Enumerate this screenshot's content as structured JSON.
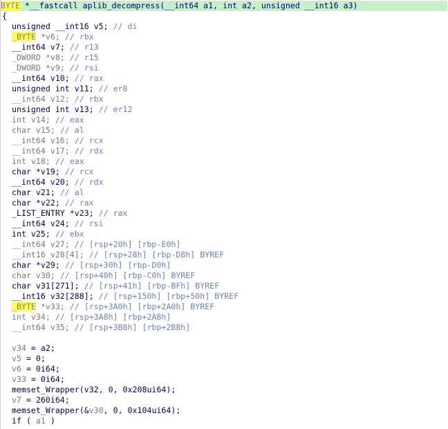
{
  "function_signature": [
    {
      "t": "BYTE",
      "c": "hl"
    },
    {
      "t": " *__fastcall aplib_decompress(__int64 a1, int a2, unsigned __int16 a3)",
      "c": "kw"
    }
  ],
  "lines": [
    [
      {
        "t": "{",
        "c": "kw"
      }
    ],
    [
      {
        "t": "unsigned __int16 v5; ",
        "c": "kw"
      },
      {
        "t": "// di",
        "c": "cm"
      }
    ],
    [
      {
        "t": "_BYTE",
        "c": "hl"
      },
      {
        "t": " *v6; ",
        "c": "dim"
      },
      {
        "t": "// rbx",
        "c": "cm"
      }
    ],
    [
      {
        "t": "__int64 v7; ",
        "c": "kw"
      },
      {
        "t": "// r13",
        "c": "cm"
      }
    ],
    [
      {
        "t": "_DWORD *v8; ",
        "c": "dim"
      },
      {
        "t": "// r15",
        "c": "cm"
      }
    ],
    [
      {
        "t": "_DWORD *v9; ",
        "c": "dim"
      },
      {
        "t": "// rsi",
        "c": "cm"
      }
    ],
    [
      {
        "t": "__int64 v10; ",
        "c": "kw"
      },
      {
        "t": "// rax",
        "c": "cm"
      }
    ],
    [
      {
        "t": "unsigned int v11; ",
        "c": "kw"
      },
      {
        "t": "// er8",
        "c": "cm"
      }
    ],
    [
      {
        "t": "__int64 v12; ",
        "c": "dim"
      },
      {
        "t": "// rbx",
        "c": "cm"
      }
    ],
    [
      {
        "t": "unsigned int v13; ",
        "c": "kw"
      },
      {
        "t": "// er12",
        "c": "cm"
      }
    ],
    [
      {
        "t": "int v14; ",
        "c": "dim"
      },
      {
        "t": "// eax",
        "c": "cm"
      }
    ],
    [
      {
        "t": "char v15; ",
        "c": "dim"
      },
      {
        "t": "// al",
        "c": "cm"
      }
    ],
    [
      {
        "t": "__int64 v16; ",
        "c": "dim"
      },
      {
        "t": "// rcx",
        "c": "cm"
      }
    ],
    [
      {
        "t": "__int64 v17; ",
        "c": "dim"
      },
      {
        "t": "// rdx",
        "c": "cm"
      }
    ],
    [
      {
        "t": "int v18; ",
        "c": "dim"
      },
      {
        "t": "// eax",
        "c": "cm"
      }
    ],
    [
      {
        "t": "char *v19; ",
        "c": "kw"
      },
      {
        "t": "// rcx",
        "c": "cm"
      }
    ],
    [
      {
        "t": "__int64 v20; ",
        "c": "kw"
      },
      {
        "t": "// rdx",
        "c": "cm"
      }
    ],
    [
      {
        "t": "char v21; ",
        "c": "kw"
      },
      {
        "t": "// al",
        "c": "cm"
      }
    ],
    [
      {
        "t": "char *v22; ",
        "c": "kw"
      },
      {
        "t": "// rax",
        "c": "cm"
      }
    ],
    [
      {
        "t": "_LIST_ENTRY *v23; ",
        "c": "kw"
      },
      {
        "t": "// rax",
        "c": "cm"
      }
    ],
    [
      {
        "t": "__int64 v24; ",
        "c": "kw"
      },
      {
        "t": "// rsi",
        "c": "cm"
      }
    ],
    [
      {
        "t": "int v25; ",
        "c": "kw"
      },
      {
        "t": "// ebx",
        "c": "cm"
      }
    ],
    [
      {
        "t": "__int64 v27; ",
        "c": "dim"
      },
      {
        "t": "// [rsp+20h] [rbp-E0h]",
        "c": "cm"
      }
    ],
    [
      {
        "t": "__int16 v28[4]; ",
        "c": "dim"
      },
      {
        "t": "// [rsp+28h] [rbp-D8h] BYREF",
        "c": "cm"
      }
    ],
    [
      {
        "t": "char *v29; ",
        "c": "kw"
      },
      {
        "t": "// [rsp+30h] [rbp-D0h]",
        "c": "cm"
      }
    ],
    [
      {
        "t": "char v30; ",
        "c": "dim"
      },
      {
        "t": "// [rsp+40h] [rbp-C0h] BYREF",
        "c": "cm"
      }
    ],
    [
      {
        "t": "char v31[271]; ",
        "c": "kw"
      },
      {
        "t": "// [rsp+41h] [rbp-BFh] BYREF",
        "c": "cm"
      }
    ],
    [
      {
        "t": "__int16 v32[288]; ",
        "c": "kw"
      },
      {
        "t": "// [rsp+150h] [rbp+50h] BYREF",
        "c": "cm"
      }
    ],
    [
      {
        "t": "_BYTE",
        "c": "hl"
      },
      {
        "t": " *v33; ",
        "c": "dim"
      },
      {
        "t": "// [rsp+3A0h] [rbp+2A0h] BYREF",
        "c": "cm"
      }
    ],
    [
      {
        "t": "int v34; ",
        "c": "dim"
      },
      {
        "t": "// [rsp+3A8h] [rbp+2A8h]",
        "c": "cm"
      }
    ],
    [
      {
        "t": "__int64 v35; ",
        "c": "dim"
      },
      {
        "t": "// [rsp+3B8h] [rbp+2B8h]",
        "c": "cm"
      }
    ],
    [],
    [
      {
        "t": "v34",
        "c": "dim"
      },
      {
        "t": " = a2;",
        "c": "kw"
      }
    ],
    [
      {
        "t": "v5",
        "c": "dim"
      },
      {
        "t": " = 0;",
        "c": "kw"
      }
    ],
    [
      {
        "t": "v6",
        "c": "dim"
      },
      {
        "t": " = 0i64;",
        "c": "kw"
      }
    ],
    [
      {
        "t": "v33",
        "c": "dim"
      },
      {
        "t": " = 0i64;",
        "c": "kw"
      }
    ],
    [
      {
        "t": "memset_Wrapper",
        "c": "kw"
      },
      {
        "t": "(v32, 0, 0x208ui64);",
        "c": "kw"
      }
    ],
    [
      {
        "t": "v7",
        "c": "dim"
      },
      {
        "t": " = 260i64;",
        "c": "kw"
      }
    ],
    [
      {
        "t": "memset_Wrapper",
        "c": "kw"
      },
      {
        "t": "(&",
        "c": "kw"
      },
      {
        "t": "v30",
        "c": "dim"
      },
      {
        "t": ", 0, 0x104ui64);",
        "c": "kw"
      }
    ],
    [
      {
        "t": "if ( ",
        "c": "kw"
      },
      {
        "t": "a1",
        "c": "dim"
      },
      {
        "t": " )",
        "c": "kw"
      }
    ]
  ]
}
